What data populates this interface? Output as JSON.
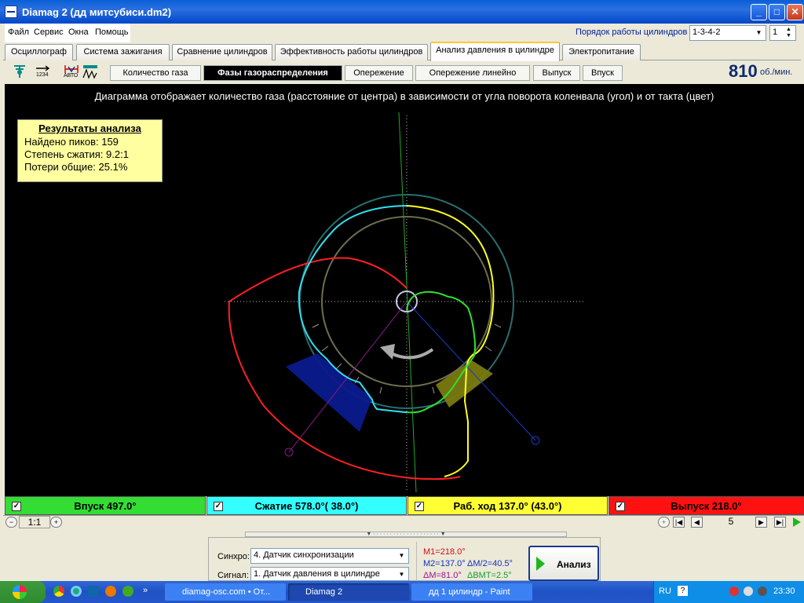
{
  "window": {
    "title": "Diamag 2 (дд митсубиси.dm2)"
  },
  "menu": [
    "Файл",
    "Сервис",
    "Окна",
    "Помощь"
  ],
  "cylinder_order": {
    "label": "Порядок работы цилиндров",
    "value": "1-3-4-2",
    "cylinder": "1"
  },
  "tabs": [
    "Осциллограф",
    "Система зажигания",
    "Сравнение цилиндров",
    "Эффективность работы цилиндров",
    "Анализ давления в цилиндре",
    "Электропитание"
  ],
  "active_tab": "Анализ давления в цилиндре",
  "toolbar_icons": [
    "antenna-icon",
    "counter-1234-icon",
    "auto-icon",
    "peaks-icon"
  ],
  "toolbar_icon_text": {
    "counter": "1234",
    "auto": "АВТО"
  },
  "subtabs": [
    "Количество газа",
    "Фазы газораспределения",
    "Опережение",
    "Опережение линейно",
    "Выпуск",
    "Впуск"
  ],
  "active_subtab": "Фазы газораспределения",
  "rpm": {
    "value": "810",
    "unit": "об./мин."
  },
  "diagram": {
    "caption": "Диаграмма отображает количество газа (расстояние от центра) в зависимости от угла поворота коленвала (угол) и от такта (цвет)"
  },
  "results": {
    "title": "Результаты анализа",
    "peaks": "Найдено пиков: 159",
    "compression": "Степень сжатия: 9.2:1",
    "losses": "Потери общие: 25.1%"
  },
  "strokes": [
    {
      "label": "Впуск 497.0°",
      "color": "#33DD33"
    },
    {
      "label": "Сжатие 578.0°( 38.0°)",
      "color": "#33FFFF"
    },
    {
      "label": "Раб. ход 137.0° (43.0°)",
      "color": "#FFFF33"
    },
    {
      "label": "Выпуск 218.0°",
      "color": "#FF1111"
    }
  ],
  "zoom": {
    "value": "1:1"
  },
  "page_nav": {
    "value": "5"
  },
  "sync": {
    "label": "Синхро:",
    "value": "4. Датчик синхронизации"
  },
  "signal": {
    "label": "Сигнал:",
    "value": "1. Датчик давления в цилиндре"
  },
  "markers": {
    "m1": "M1=218.0°",
    "m2": "M2=137.0°",
    "dm2": "ΔM/2=40.5°",
    "dm": "ΔM=81.0°",
    "dbmt": "ΔВМТ=2.5°"
  },
  "analyze_button": "Анализ",
  "taskbar": {
    "tasks": [
      "diamag-osc.com • От...",
      "Diamag 2",
      "дд 1 цилиндр - Paint"
    ],
    "lang": "RU",
    "time": "23:30"
  }
}
